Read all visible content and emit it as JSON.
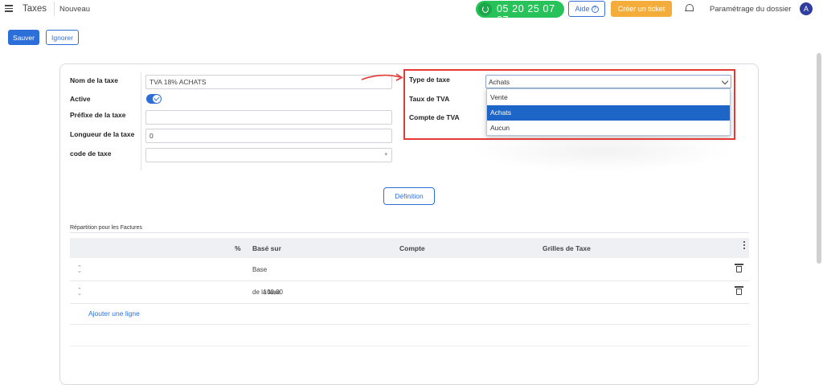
{
  "topbar": {
    "app_title": "Taxes",
    "breadcrumb": "Nouveau",
    "phone": "05 20 25 07 07",
    "help_label": "Aide",
    "help_icon": "?",
    "ticket_label": "Créer un ticket",
    "settings_label": "Paramétrage du dossier",
    "avatar_initial": "A"
  },
  "toolbar": {
    "save_label": "Sauver",
    "ignore_label": "Ignorer"
  },
  "form": {
    "name_label": "Nom de la taxe",
    "name_value": "TVA 18% ACHATS",
    "active_label": "Active",
    "active_value": true,
    "prefix_label": "Préfixe de la taxe",
    "prefix_value": "",
    "length_label": "Longueur de la taxe",
    "length_value": "0",
    "code_label": "code de taxe",
    "code_value": "",
    "type_label": "Type de taxe",
    "type_value": "Achats",
    "rate_label": "Taux de TVA",
    "account_label": "Compte de TVA",
    "type_options": [
      "Vente",
      "Achats",
      "Aucun"
    ],
    "selected_option": "Achats"
  },
  "definition_label": "Définition",
  "distribution": {
    "title": "Répartition pour les Factures",
    "columns": {
      "pct": "%",
      "based_on": "Basé sur",
      "account": "Compte",
      "grids": "Grilles de Taxe"
    },
    "rows": [
      {
        "pct": "",
        "based_on": "Base"
      },
      {
        "pct": "100,00",
        "based_on": "de la taxe"
      }
    ],
    "add_line_label": "Ajouter une ligne"
  },
  "colors": {
    "primary": "#2d6fd9",
    "phone_green": "#27c35a",
    "ticket_orange": "#f4ad3b",
    "highlight_red": "#e53935",
    "selected_option": "#1d65c7"
  }
}
